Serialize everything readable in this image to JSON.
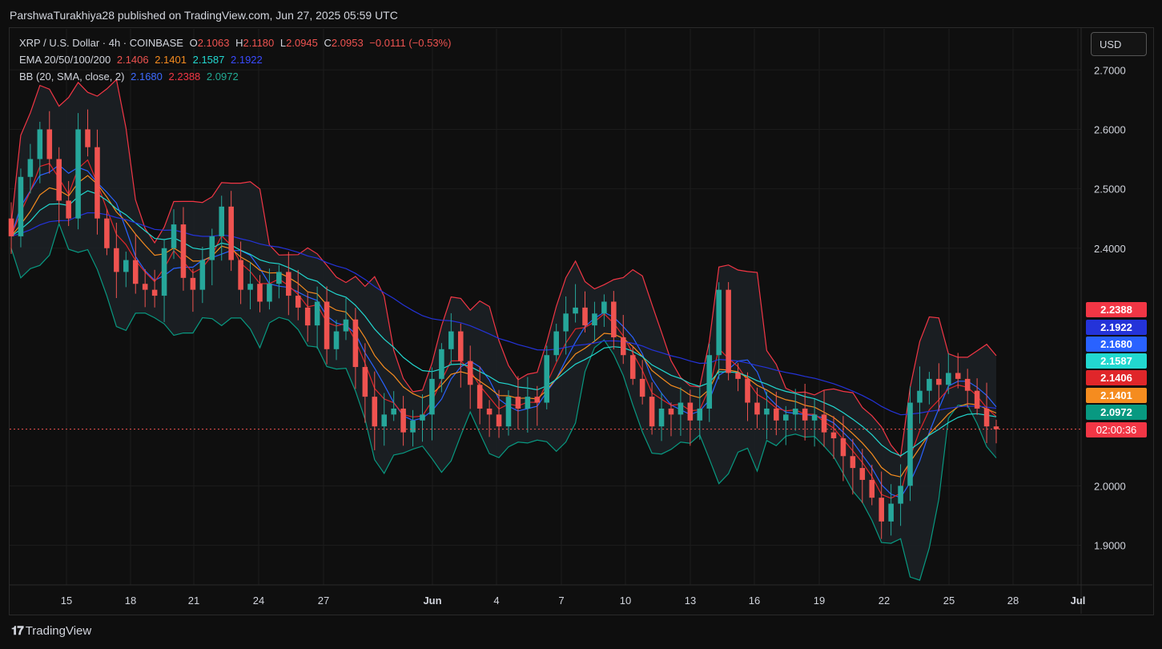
{
  "publisher_line": "ParshwaTurakhiya28 published on TradingView.com, Jun 27, 2025 05:59 UTC",
  "legend": {
    "symbol": "XRP / U.S. Dollar · 4h · COINBASE",
    "o_label": "O",
    "o": "2.1063",
    "h_label": "H",
    "h": "2.1180",
    "l_label": "L",
    "l": "2.0945",
    "c_label": "C",
    "c": "2.0953",
    "change": "−0.0111 (−0.53%)",
    "ema_label": "EMA 20/50/100/200",
    "ema20": "2.1406",
    "ema50": "2.1401",
    "ema100": "2.1587",
    "ema200": "2.1922",
    "bb_label": "BB (20, SMA, close, 2)",
    "bb_basis": "2.1680",
    "bb_upper": "2.2388",
    "bb_lower": "2.0972"
  },
  "currency_button": "USD",
  "footer_brand": "TradingView",
  "colors": {
    "up": "#26a69a",
    "down": "#ef5350",
    "ema20": "#e0262a",
    "ema50": "#f58c1f",
    "ema100": "#22d8d0",
    "ema200": "#2433d9",
    "bb_basis": "#2962ff",
    "bb_upper": "#f23645",
    "bb_lower": "#089981"
  },
  "chart_data": {
    "type": "candlestick",
    "ylim": [
      1.83,
      2.76
    ],
    "yticks": [
      "2.7000",
      "2.6000",
      "2.5000",
      "2.4000",
      "2.0000",
      "1.9000"
    ],
    "xticks": [
      "15",
      "18",
      "21",
      "24",
      "27",
      "Jun",
      "4",
      "7",
      "10",
      "13",
      "16",
      "19",
      "22",
      "25",
      "28",
      "Jul"
    ],
    "current_price": 2.0953,
    "countdown": "02:00:36",
    "price_tags": [
      {
        "name": "bb-upper",
        "value": 2.2388,
        "label": "2.2388",
        "color": "#f23645"
      },
      {
        "name": "ema200",
        "value": 2.1922,
        "label": "2.1922",
        "color": "#2433d9"
      },
      {
        "name": "bb-basis",
        "value": 2.168,
        "label": "2.1680",
        "color": "#2962ff"
      },
      {
        "name": "ema100",
        "value": 2.1587,
        "label": "2.1587",
        "color": "#22d8d0"
      },
      {
        "name": "ema20",
        "value": 2.1406,
        "label": "2.1406",
        "color": "#e0262a"
      },
      {
        "name": "ema50",
        "value": 2.1401,
        "label": "2.1401",
        "color": "#f58c1f"
      },
      {
        "name": "bb-lower",
        "value": 2.0972,
        "label": "2.0972",
        "color": "#089981"
      }
    ],
    "closes": [
      2.42,
      2.52,
      2.55,
      2.6,
      2.55,
      2.48,
      2.45,
      2.6,
      2.57,
      2.45,
      2.4,
      2.36,
      2.38,
      2.34,
      2.33,
      2.32,
      2.4,
      2.44,
      2.35,
      2.33,
      2.38,
      2.42,
      2.47,
      2.38,
      2.33,
      2.34,
      2.31,
      2.34,
      2.36,
      2.32,
      2.3,
      2.27,
      2.31,
      2.23,
      2.26,
      2.28,
      2.2,
      2.15,
      2.1,
      2.12,
      2.13,
      2.09,
      2.11,
      2.12,
      2.18,
      2.23,
      2.26,
      2.21,
      2.17,
      2.13,
      2.12,
      2.1,
      2.15,
      2.13,
      2.15,
      2.14,
      2.22,
      2.26,
      2.29,
      2.3,
      2.27,
      2.29,
      2.31,
      2.25,
      2.22,
      2.18,
      2.15,
      2.1,
      2.13,
      2.12,
      2.14,
      2.11,
      2.13,
      2.22,
      2.33,
      2.19,
      2.18,
      2.14,
      2.12,
      2.13,
      2.11,
      2.12,
      2.13,
      2.11,
      2.12,
      2.09,
      2.08,
      2.05,
      2.03,
      2.01,
      1.98,
      1.94,
      1.97,
      2.0,
      2.14,
      2.16,
      2.18,
      2.17,
      2.19,
      2.18,
      2.16,
      2.13,
      2.1,
      2.0953
    ]
  }
}
